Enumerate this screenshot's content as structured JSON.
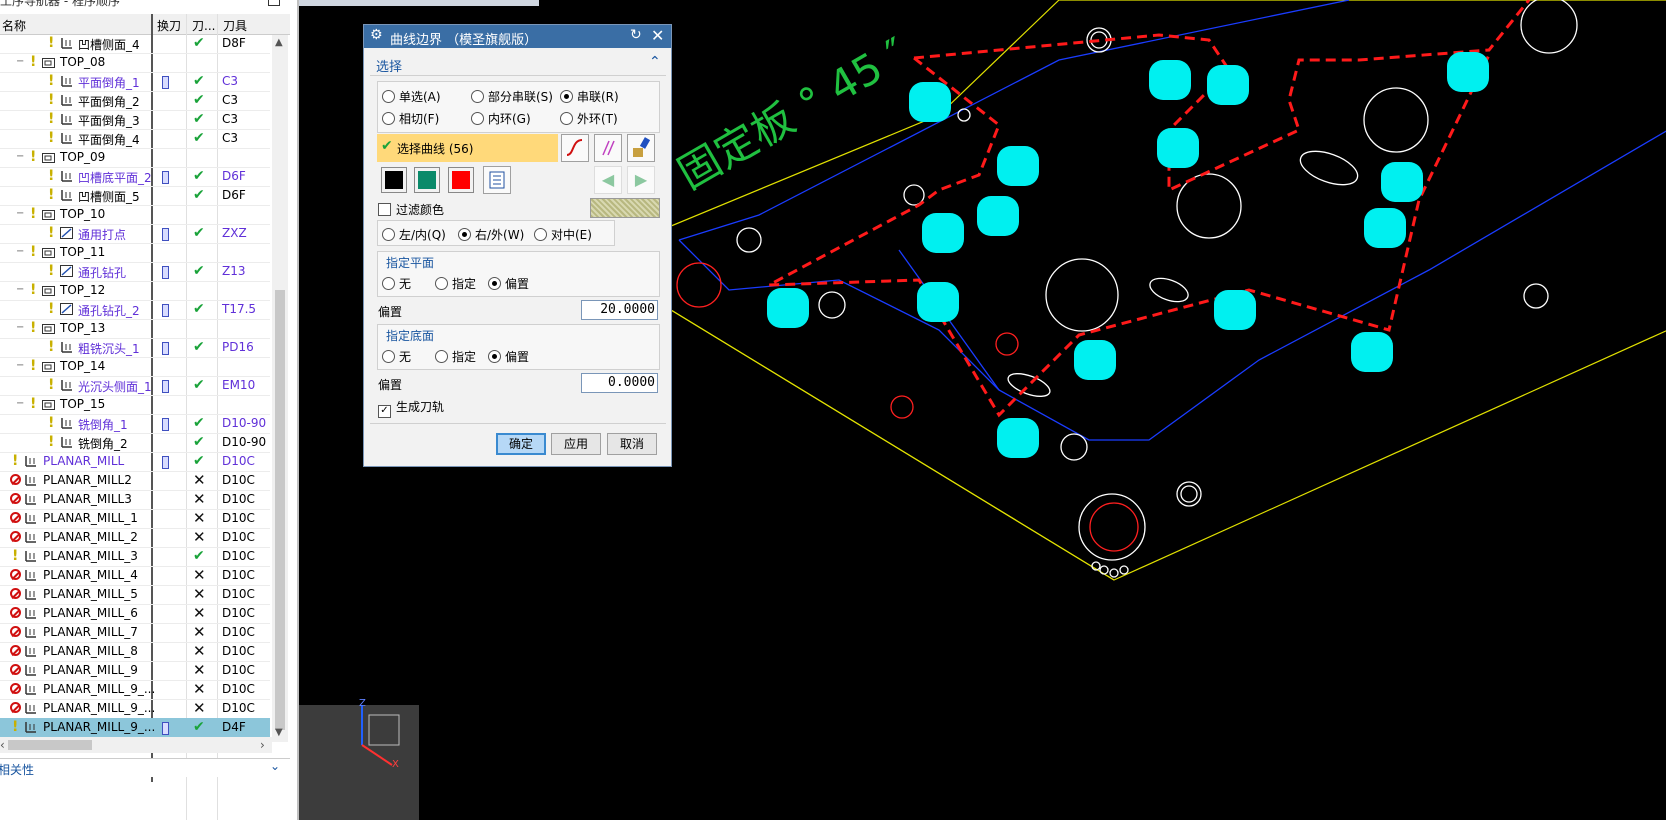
{
  "navigator": {
    "title": "工序导航器 - 程序顺序",
    "headers": {
      "name": "名称",
      "tool_change": "换刀",
      "path": "刀...",
      "tool": "刀具"
    },
    "rows": [
      {
        "name": "凹槽侧面_4",
        "tool": "D8F",
        "level": 3,
        "type": "mill-wall",
        "swap": false,
        "status": "ok",
        "purple": false
      },
      {
        "name": "TOP_08",
        "tool": "",
        "level": 1,
        "type": "group",
        "swap": false,
        "status": "",
        "purple": false
      },
      {
        "name": "平面倒角_1",
        "tool": "C3",
        "level": 2,
        "type": "planar",
        "swap": true,
        "status": "ok",
        "purple": true
      },
      {
        "name": "平面倒角_2",
        "tool": "C3",
        "level": 2,
        "type": "planar",
        "swap": false,
        "status": "ok",
        "purple": false
      },
      {
        "name": "平面倒角_3",
        "tool": "C3",
        "level": 2,
        "type": "planar",
        "swap": false,
        "status": "ok",
        "purple": false
      },
      {
        "name": "平面倒角_4",
        "tool": "C3",
        "level": 2,
        "type": "planar",
        "swap": false,
        "status": "ok",
        "purple": false
      },
      {
        "name": "TOP_09",
        "tool": "",
        "level": 1,
        "type": "group",
        "swap": false,
        "status": "",
        "purple": false
      },
      {
        "name": "凹槽底平面_2",
        "tool": "D6F",
        "level": 2,
        "type": "floor",
        "swap": true,
        "status": "ok",
        "purple": true
      },
      {
        "name": "凹槽侧面_5",
        "tool": "D6F",
        "level": 2,
        "type": "mill-wall",
        "swap": false,
        "status": "ok",
        "purple": false
      },
      {
        "name": "TOP_10",
        "tool": "",
        "level": 1,
        "type": "group",
        "swap": false,
        "status": "",
        "purple": false
      },
      {
        "name": "通用打点",
        "tool": "ZXZ",
        "level": 2,
        "type": "drill",
        "swap": true,
        "status": "ok",
        "purple": true
      },
      {
        "name": "TOP_11",
        "tool": "",
        "level": 1,
        "type": "group",
        "swap": false,
        "status": "",
        "purple": false
      },
      {
        "name": "通孔钻孔",
        "tool": "Z13",
        "level": 2,
        "type": "drill",
        "swap": true,
        "status": "ok",
        "purple": true
      },
      {
        "name": "TOP_12",
        "tool": "",
        "level": 1,
        "type": "group",
        "swap": false,
        "status": "",
        "purple": false
      },
      {
        "name": "通孔钻孔_2",
        "tool": "T17.5",
        "level": 2,
        "type": "drill",
        "swap": true,
        "status": "ok",
        "purple": true
      },
      {
        "name": "TOP_13",
        "tool": "",
        "level": 1,
        "type": "group",
        "swap": false,
        "status": "",
        "purple": false
      },
      {
        "name": "粗铣沉头_1",
        "tool": "PD16",
        "level": 2,
        "type": "hole",
        "swap": true,
        "status": "ok",
        "purple": true
      },
      {
        "name": "TOP_14",
        "tool": "",
        "level": 1,
        "type": "group",
        "swap": false,
        "status": "",
        "purple": false
      },
      {
        "name": "光沉头侧面_1",
        "tool": "EM10",
        "level": 2,
        "type": "planar",
        "swap": true,
        "status": "ok",
        "purple": true
      },
      {
        "name": "TOP_15",
        "tool": "",
        "level": 1,
        "type": "group",
        "swap": false,
        "status": "",
        "purple": false
      },
      {
        "name": "铣倒角_1",
        "tool": "D10-90",
        "level": 2,
        "type": "planar",
        "swap": true,
        "status": "ok",
        "purple": true
      },
      {
        "name": "铣倒角_2",
        "tool": "D10-90",
        "level": 2,
        "type": "planar",
        "swap": false,
        "status": "ok",
        "purple": false
      },
      {
        "name": "PLANAR_MILL",
        "tool": "D10C",
        "level": 0,
        "type": "planar",
        "swap": true,
        "status": "ok",
        "purple": true
      },
      {
        "name": "PLANAR_MILL2",
        "tool": "D10C",
        "level": 0,
        "type": "planar",
        "swap": false,
        "status": "x",
        "purple": false
      },
      {
        "name": "PLANAR_MILL3",
        "tool": "D10C",
        "level": 0,
        "type": "planar",
        "swap": false,
        "status": "x",
        "purple": false
      },
      {
        "name": "PLANAR_MILL_1",
        "tool": "D10C",
        "level": 0,
        "type": "planar",
        "swap": false,
        "status": "x",
        "purple": false
      },
      {
        "name": "PLANAR_MILL_2",
        "tool": "D10C",
        "level": 0,
        "type": "planar",
        "swap": false,
        "status": "x",
        "purple": false
      },
      {
        "name": "PLANAR_MILL_3",
        "tool": "D10C",
        "level": 0,
        "type": "planar",
        "swap": false,
        "status": "ok",
        "purple": false
      },
      {
        "name": "PLANAR_MILL_4",
        "tool": "D10C",
        "level": 0,
        "type": "planar",
        "swap": false,
        "status": "x",
        "purple": false
      },
      {
        "name": "PLANAR_MILL_5",
        "tool": "D10C",
        "level": 0,
        "type": "planar",
        "swap": false,
        "status": "x",
        "purple": false
      },
      {
        "name": "PLANAR_MILL_6",
        "tool": "D10C",
        "level": 0,
        "type": "planar",
        "swap": false,
        "status": "x",
        "purple": false
      },
      {
        "name": "PLANAR_MILL_7",
        "tool": "D10C",
        "level": 0,
        "type": "planar",
        "swap": false,
        "status": "x",
        "purple": false
      },
      {
        "name": "PLANAR_MILL_8",
        "tool": "D10C",
        "level": 0,
        "type": "planar",
        "swap": false,
        "status": "x",
        "purple": false
      },
      {
        "name": "PLANAR_MILL_9",
        "tool": "D10C",
        "level": 0,
        "type": "planar",
        "swap": false,
        "status": "x",
        "purple": false
      },
      {
        "name": "PLANAR_MILL_9_...",
        "tool": "D10C",
        "level": 0,
        "type": "planar",
        "swap": false,
        "status": "x",
        "purple": false
      },
      {
        "name": "PLANAR_MILL_9_...",
        "tool": "D10C",
        "level": 0,
        "type": "planar",
        "swap": false,
        "status": "x",
        "purple": false
      },
      {
        "name": "PLANAR_MILL_9_...",
        "tool": "D4F",
        "level": 0,
        "type": "planar",
        "swap": true,
        "status": "ok",
        "purple": false,
        "selected": true
      }
    ],
    "bottom_label": "相关性"
  },
  "dialog": {
    "title": "曲线边界 （模圣旗舰版）",
    "section": "选择",
    "mode_options": [
      {
        "label": "单选(A)",
        "checked": false
      },
      {
        "label": "部分串联(S)",
        "checked": false
      },
      {
        "label": "串联(R)",
        "checked": true
      },
      {
        "label": "相切(F)",
        "checked": false
      },
      {
        "label": "内环(G)",
        "checked": false
      },
      {
        "label": "外环(T)",
        "checked": false
      }
    ],
    "select_curve": "选择曲线 (56)",
    "filter_color": "过滤颜色",
    "side_options": [
      {
        "label": "左/内(Q)",
        "checked": false
      },
      {
        "label": "右/外(W)",
        "checked": true
      },
      {
        "label": "对中(E)",
        "checked": false
      }
    ],
    "plane": {
      "label": "指定平面",
      "options": [
        {
          "label": "无",
          "checked": false
        },
        {
          "label": "指定",
          "checked": false
        },
        {
          "label": "偏置",
          "checked": true
        }
      ],
      "offset_label": "偏置",
      "offset_value": "20.0000"
    },
    "floor": {
      "label": "指定底面",
      "options": [
        {
          "label": "无",
          "checked": false
        },
        {
          "label": "指定",
          "checked": false
        },
        {
          "label": "偏置",
          "checked": true
        }
      ],
      "offset_label": "偏置",
      "offset_value": "0.0000"
    },
    "generate_toolpath": "生成刀轨",
    "buttons": {
      "ok": "确定",
      "apply": "应用",
      "cancel": "取消"
    },
    "swatch_colors": [
      "#000000",
      "#0a8a6a",
      "#ff0000"
    ]
  },
  "viewport": {
    "engraving": "固定板 ° 45 ″",
    "axis": {
      "z": "Z",
      "x": "X"
    }
  }
}
